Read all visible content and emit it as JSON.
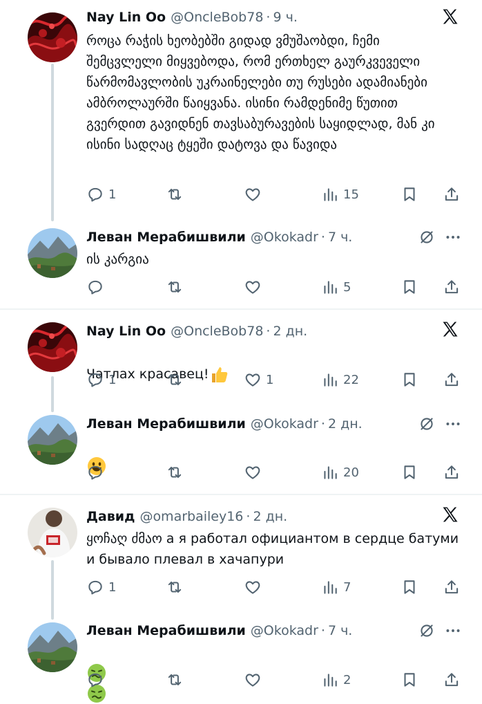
{
  "tweets": [
    {
      "name": "Nay Lin Oo",
      "handle": "@OncleBob78",
      "time": "9 ч.",
      "avatar": "red-art-avatar",
      "text": "როცა რაჭის ხეობებში გიდად ვმუშაობდი, ჩემი შემცვლელი მიყვებოდა, რომ ერთხელ გაურკვეველი წარმომავლობის უკრაინელები თუ რუსები ადამიანები ამბროლაურში წაიყვანა. ისინი რამდენიმე წუთით გვერდით გავიდნენ თავსაბურავების საყიდლად, მან კი ისინი სადღაც ტყეში დატოვა და წავიდა",
      "replies": "1",
      "retweets": "",
      "likes": "",
      "views": "15"
    },
    {
      "name": "Леван Мерабишвили",
      "handle": "@Okokadr",
      "time": "7 ч.",
      "avatar": "mountain-avatar",
      "text": "ის კარგია",
      "replies": "",
      "retweets": "",
      "likes": "",
      "views": "5"
    },
    {
      "name": "Nay Lin Oo",
      "handle": "@OncleBob78",
      "time": "2 дн.",
      "avatar": "red-art-avatar",
      "text": "Чатлах красавец!",
      "emoji": "thumbs-up",
      "replies": "1",
      "retweets": "",
      "likes": "1",
      "views": "22"
    },
    {
      "name": "Леван Мерабишвили",
      "handle": "@Okokadr",
      "time": "2 дн.",
      "avatar": "mountain-avatar",
      "text": "",
      "emoji": "smiley",
      "replies": "",
      "retweets": "",
      "likes": "",
      "views": "20"
    },
    {
      "name": "Давид",
      "handle": "@omarbailey16",
      "time": "2 дн.",
      "avatar": "person-avatar",
      "text": "ყოჩაღ ძმაო а я работал официантом в сердце батуми и бывало плевал в хачапури",
      "replies": "1",
      "retweets": "",
      "likes": "",
      "views": "7"
    },
    {
      "name": "Леван Мерабишвили",
      "handle": "@Okokadr",
      "time": "7 ч.",
      "avatar": "mountain-avatar",
      "text": "",
      "emoji": "nauseated-pair",
      "replies": "",
      "retweets": "",
      "likes": "",
      "views": "2"
    }
  ],
  "colors": {
    "text": "#0f1419",
    "muted": "#536471",
    "line": "#cfd9de",
    "divider": "#eff3f4"
  },
  "icons": [
    "x-logo-icon",
    "reply-icon",
    "retweet-icon",
    "like-icon",
    "views-icon",
    "bookmark-icon",
    "share-icon",
    "grok-icon",
    "more-icon"
  ]
}
